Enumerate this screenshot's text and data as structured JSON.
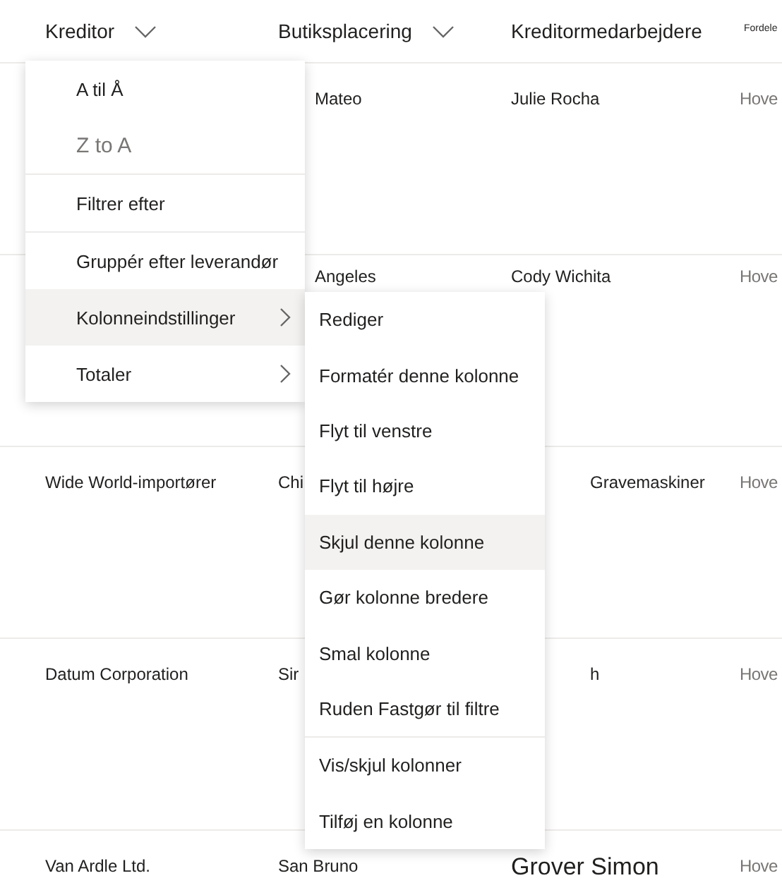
{
  "columns": [
    {
      "label": "Kreditor",
      "has_dropdown": true
    },
    {
      "label": "Butiksplacering",
      "has_dropdown": true
    },
    {
      "label": "Kreditormedarbejdere",
      "has_dropdown": false
    },
    {
      "label": "Fordele",
      "has_dropdown": false
    }
  ],
  "rows": [
    {
      "cells": [
        null,
        "Mateo",
        "Julie Rocha",
        "Hove"
      ]
    },
    {
      "cells": [
        null,
        "Angeles",
        "Cody Wichita",
        "Hove"
      ]
    },
    {
      "cells": [
        "Wide World-importører",
        "Chi",
        "Gravemaskiner",
        "Hove"
      ]
    },
    {
      "cells": [
        "Datum Corporation",
        "Sir",
        "h",
        "Hove"
      ]
    },
    {
      "cells": [
        "Van Ardle Ltd.",
        "San Bruno",
        "Grover Simon",
        "Hove"
      ]
    }
  ],
  "menu": {
    "groups": [
      [
        {
          "label": "A til Å",
          "disabled": false,
          "highlighted": false,
          "has_submenu": false
        },
        {
          "label": "Z to A",
          "disabled": true,
          "highlighted": false,
          "has_submenu": false
        }
      ],
      [
        {
          "label": "Filtrer efter",
          "disabled": false,
          "highlighted": false,
          "has_submenu": false
        }
      ],
      [
        {
          "label": "Gruppér efter leverandør",
          "disabled": false,
          "highlighted": false,
          "has_submenu": false
        },
        {
          "label": "Kolonneindstillinger",
          "disabled": false,
          "highlighted": true,
          "has_submenu": true
        },
        {
          "label": "Totaler",
          "disabled": false,
          "highlighted": false,
          "has_submenu": true
        }
      ]
    ]
  },
  "submenu": {
    "groups": [
      [
        {
          "label": "Rediger",
          "highlighted": false
        },
        {
          "label": "Formatér denne kolonne",
          "highlighted": false
        },
        {
          "label": "Flyt til venstre",
          "highlighted": false
        },
        {
          "label": "Flyt til højre",
          "highlighted": false
        },
        {
          "label": "Skjul denne kolonne",
          "highlighted": true
        },
        {
          "label": "Gør kolonne bredere",
          "highlighted": false
        },
        {
          "label": "Smal kolonne",
          "highlighted": false
        },
        {
          "label": "Ruden Fastgør til filtre",
          "highlighted": false
        }
      ],
      [
        {
          "label": "Vis/skjul kolonner",
          "highlighted": false
        },
        {
          "label": "Tilføj en kolonne",
          "highlighted": false
        }
      ]
    ]
  }
}
